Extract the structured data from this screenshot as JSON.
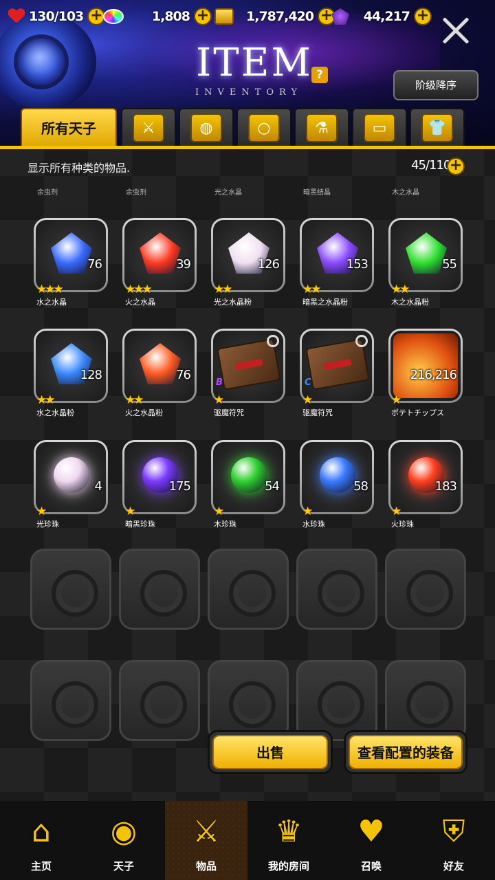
{
  "resources": {
    "hp_current": "130",
    "hp_max": "/103",
    "gems": "1,808",
    "gold": "1,787,420",
    "souls": "44,217"
  },
  "header": {
    "title": "ITEM",
    "subtitle": "INVENTORY",
    "help": "?",
    "sort_button": "阶级降序"
  },
  "tabs": [
    {
      "label": "所有天子",
      "icon": "all-icon",
      "active": true
    },
    {
      "label": "",
      "icon": "sword-icon"
    },
    {
      "label": "",
      "icon": "shield-icon"
    },
    {
      "label": "",
      "icon": "ring-icon"
    },
    {
      "label": "",
      "icon": "potion-icon"
    },
    {
      "label": "",
      "icon": "card-icon"
    },
    {
      "label": "",
      "icon": "shirt-icon"
    }
  ],
  "info": {
    "description": "显示所有种类的物品.",
    "count": "45/110"
  },
  "category_labels": [
    "余虫剂",
    "余虫剂",
    "光之水晶",
    "暗黑结晶",
    "木之水晶"
  ],
  "items": [
    {
      "name": "水之水晶",
      "qty": "76",
      "stars": 3,
      "kind": "crystal",
      "color": "#3a6bff"
    },
    {
      "name": "火之水晶",
      "qty": "39",
      "stars": 3,
      "kind": "crystal",
      "color": "#ff3a20"
    },
    {
      "name": "光之水晶粉",
      "qty": "126",
      "stars": 2,
      "kind": "crystal",
      "color": "#f0e0f0"
    },
    {
      "name": "暗黑之水晶粉",
      "qty": "153",
      "stars": 2,
      "kind": "crystal",
      "color": "#8a4aff"
    },
    {
      "name": "木之水晶粉",
      "qty": "55",
      "stars": 2,
      "kind": "crystal",
      "color": "#30e030"
    },
    {
      "name": "水之水晶粉",
      "qty": "128",
      "stars": 2,
      "kind": "crystal",
      "color": "#3a8aff"
    },
    {
      "name": "火之水晶粉",
      "qty": "76",
      "stars": 2,
      "kind": "crystal",
      "color": "#ff5a20"
    },
    {
      "name": "驱魔符咒",
      "qty": "",
      "stars": 1,
      "kind": "card",
      "grade": "B",
      "grade_color": "#b04aff"
    },
    {
      "name": "驱魔符咒",
      "qty": "",
      "stars": 1,
      "kind": "card",
      "grade": "C",
      "grade_color": "#3a8aff"
    },
    {
      "name": "ポテトチップス",
      "qty": "216,216",
      "stars": 1,
      "kind": "chips"
    },
    {
      "name": "光珍珠",
      "qty": "4",
      "stars": 1,
      "kind": "pearl",
      "color": "#f0d8f0"
    },
    {
      "name": "暗黑珍珠",
      "qty": "175",
      "stars": 1,
      "kind": "pearl",
      "color": "#7a3aff"
    },
    {
      "name": "木珍珠",
      "qty": "54",
      "stars": 1,
      "kind": "pearl",
      "color": "#30d030"
    },
    {
      "name": "水珍珠",
      "qty": "58",
      "stars": 1,
      "kind": "pearl",
      "color": "#3a7aff"
    },
    {
      "name": "火珍珠",
      "qty": "183",
      "stars": 1,
      "kind": "pearl",
      "color": "#ff4020"
    }
  ],
  "actions": {
    "sell": "出售",
    "view_equipped": "查看配置的装备"
  },
  "nav": [
    {
      "label": "主页",
      "icon": "home-icon",
      "glyph": "⌂"
    },
    {
      "label": "天子",
      "icon": "flame-icon",
      "glyph": "◉"
    },
    {
      "label": "物品",
      "icon": "sword-shield-icon",
      "glyph": "⚔",
      "active": true
    },
    {
      "label": "我的房间",
      "icon": "crown-icon",
      "glyph": "♛"
    },
    {
      "label": "召唤",
      "icon": "potion-icon",
      "glyph": "♥"
    },
    {
      "label": "好友",
      "icon": "shield-icon",
      "glyph": "⛨"
    }
  ]
}
